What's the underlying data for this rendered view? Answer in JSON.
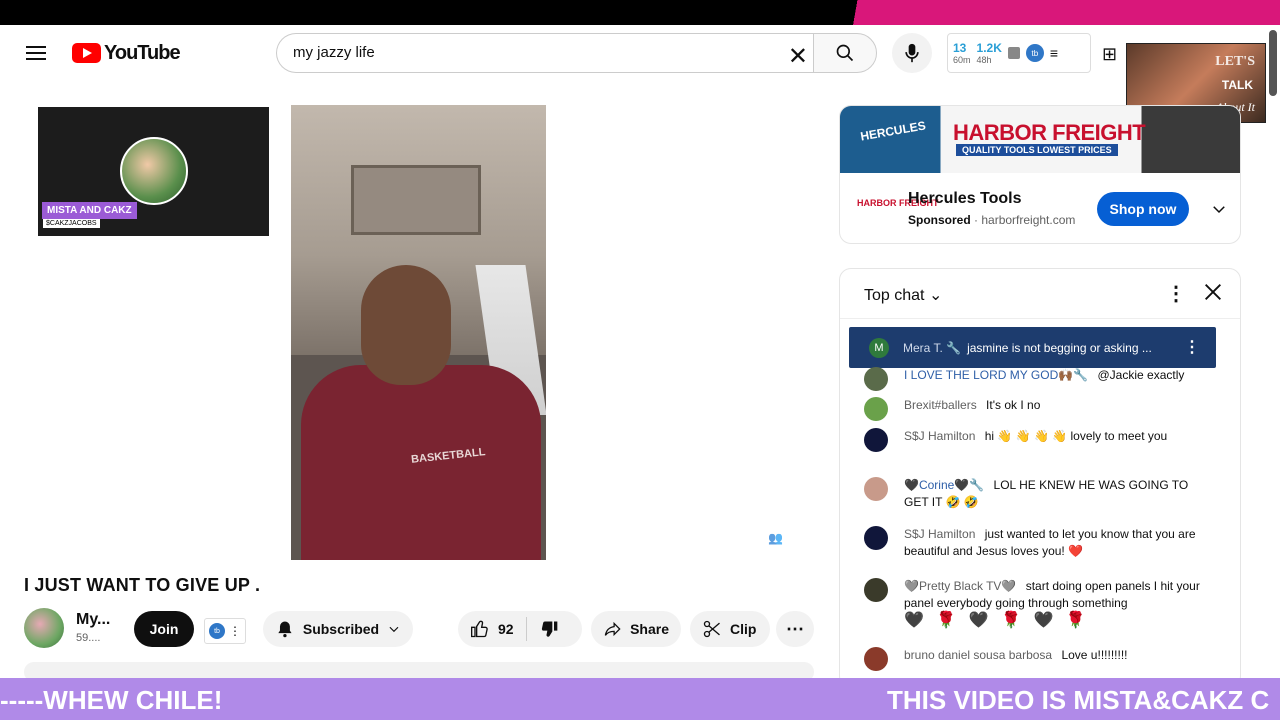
{
  "header": {
    "logo_text": "YouTube",
    "search_value": "my jazzy life",
    "stats": [
      {
        "num": "13",
        "sub": "60m"
      },
      {
        "num": "1.2K",
        "sub": "48h"
      }
    ]
  },
  "pip": {
    "line1": "LET'S",
    "line2": "TALK",
    "line3": "About It"
  },
  "left_thumb": {
    "name": "MISTA AND CAKZ",
    "handle": "$CAKZJACOBS"
  },
  "video": {
    "title": "I JUST WANT TO GIVE UP .",
    "channel_name": "My...",
    "subs": "59....",
    "join_label": "Join",
    "subscribed_label": "Subscribed",
    "likes": "92",
    "share_label": "Share",
    "clip_label": "Clip",
    "shirt_text": "BASKETBALL"
  },
  "ad": {
    "banner_brand": "HARBOR FREIGHT",
    "banner_tag": "QUALITY TOOLS   LOWEST PRICES",
    "banner_product": "HERCULES",
    "logo_text": "HARBOR FREIGHT",
    "title": "Hercules Tools",
    "sponsored": "Sponsored",
    "domain": "· harborfreight.com",
    "cta": "Shop now"
  },
  "chat": {
    "header": "Top chat",
    "pinned": {
      "initial": "M",
      "author": "Mera T. 🔧",
      "text": "jasmine is not begging or asking ..."
    },
    "messages": [
      {
        "author": "I LOVE THE LORD MY GOD🙌🏾🔧",
        "text": "@Jackie exactly"
      },
      {
        "author": "Brexit#ballers",
        "text": "It's ok I no"
      },
      {
        "author": "S$J Hamilton",
        "text": "hi 👋 👋 👋 👋 lovely to meet you"
      },
      {
        "author": "🖤Corine🖤🔧",
        "text": "LOL HE KNEW HE WAS GOING TO GET IT 🤣 🤣"
      },
      {
        "author": "S$J Hamilton",
        "text": "just wanted to let you know that you are beautiful and Jesus loves you! ❤️"
      },
      {
        "author": "🩶Pretty Black TV🩶",
        "text": "start doing open panels I hit your panel everybody going through something"
      },
      {
        "author": "bruno daniel sousa barbosa",
        "text": "Love u!!!!!!!!!"
      }
    ],
    "emoji_row": "🖤 🌹 🖤 🌹 🖤 🌹"
  },
  "ticker": {
    "left": "-----WHEW CHILE!",
    "right": "THIS VIDEO IS MISTA&CAKZ C"
  },
  "colors": {
    "accent_red": "#ff0000",
    "ticker_purple": "#b08ae8",
    "shop_blue": "#065fd4",
    "pinned_navy": "#1d3c6e"
  }
}
